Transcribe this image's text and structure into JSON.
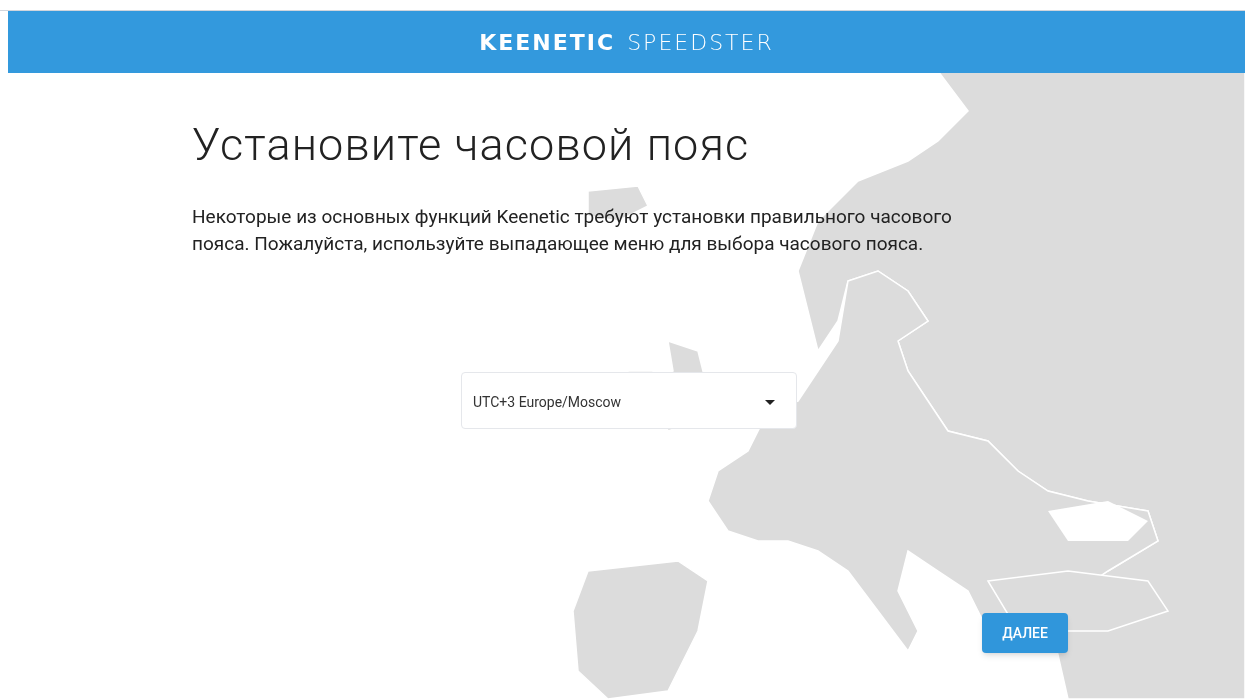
{
  "header": {
    "brand": "KEENETIC",
    "product": "SPEEDSTER"
  },
  "title": "Установите часовой пояс",
  "description": "Некоторые из основных функций Keenetic требуют установки правильного часового пояса. Пожалуйста, используйте выпадающее меню для выбора часового пояса.",
  "timezone_select": {
    "value": "UTC+3 Europe/Moscow"
  },
  "next_button": {
    "label": "ДАЛЕЕ"
  }
}
